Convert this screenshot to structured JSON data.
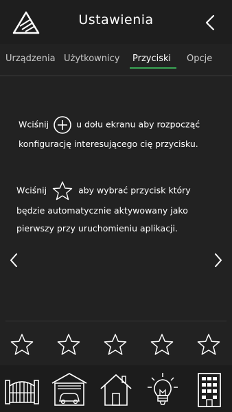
{
  "header": {
    "title": "Ustawienia",
    "logo_icon": "triangle-logo-icon",
    "back_icon": "chevron-left-icon"
  },
  "tabs": [
    {
      "label": "Urządzenia",
      "active": false
    },
    {
      "label": "Użytkownicy",
      "active": false
    },
    {
      "label": "Przyciski",
      "active": true
    },
    {
      "label": "Opcje",
      "active": false
    }
  ],
  "info": {
    "line1_before": "Wciśnij",
    "line1_after": "u dołu ekranu aby rozpocząć",
    "line2": "konfigurację interesującego cię przycisku.",
    "line3_before": "Wciśnij",
    "line3_after": "aby wybrać przycisk który",
    "line4": "będzie automatycznie aktywowany jako",
    "line5": "pierwszy przy uruchomieniu aplikacji."
  },
  "favorites": {
    "star_count": 5
  },
  "bottom_nav": [
    {
      "name": "gate-icon"
    },
    {
      "name": "garage-icon"
    },
    {
      "name": "house-icon"
    },
    {
      "name": "lightbulb-icon"
    },
    {
      "name": "building-icon"
    }
  ],
  "colors": {
    "background": "#222222",
    "accent": "#3aa655",
    "text": "#ffffff"
  }
}
